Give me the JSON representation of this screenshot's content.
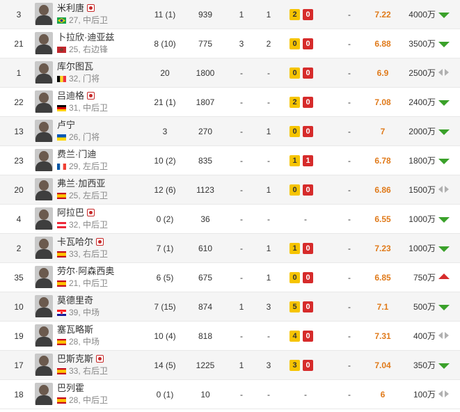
{
  "players": [
    {
      "number": "3",
      "name": "米利唐",
      "captain": true,
      "flag": "brazil",
      "age_pos": "27, 中后卫",
      "apps": "11 (1)",
      "minutes": "939",
      "goals": "1",
      "assists": "1",
      "yellow": "2",
      "red": "0",
      "plus": "-",
      "rating": "7.22",
      "value": "4000万",
      "trend": "down"
    },
    {
      "number": "21",
      "name": "卜拉欣·迪亚兹",
      "captain": false,
      "flag": "morocco",
      "age_pos": "25, 右边锋",
      "apps": "8 (10)",
      "minutes": "775",
      "goals": "3",
      "assists": "2",
      "yellow": "0",
      "red": "0",
      "plus": "-",
      "rating": "6.88",
      "value": "3500万",
      "trend": "down"
    },
    {
      "number": "1",
      "name": "库尔图瓦",
      "captain": false,
      "flag": "belgium",
      "age_pos": "32, 门将",
      "apps": "20",
      "minutes": "1800",
      "goals": "-",
      "assists": "-",
      "yellow": "0",
      "red": "0",
      "plus": "-",
      "rating": "6.9",
      "value": "2500万",
      "trend": "flat"
    },
    {
      "number": "22",
      "name": "吕迪格",
      "captain": true,
      "flag": "germany",
      "age_pos": "31, 中后卫",
      "apps": "21 (1)",
      "minutes": "1807",
      "goals": "-",
      "assists": "-",
      "yellow": "2",
      "red": "0",
      "plus": "-",
      "rating": "7.08",
      "value": "2400万",
      "trend": "down"
    },
    {
      "number": "13",
      "name": "卢宁",
      "captain": false,
      "flag": "ukraine",
      "age_pos": "26, 门将",
      "apps": "3",
      "minutes": "270",
      "goals": "-",
      "assists": "1",
      "yellow": "0",
      "red": "0",
      "plus": "-",
      "rating": "7",
      "value": "2000万",
      "trend": "down"
    },
    {
      "number": "23",
      "name": "费兰·门迪",
      "captain": false,
      "flag": "france",
      "age_pos": "29, 左后卫",
      "apps": "10 (2)",
      "minutes": "835",
      "goals": "-",
      "assists": "-",
      "yellow": "1",
      "red": "1",
      "plus": "-",
      "rating": "6.78",
      "value": "1800万",
      "trend": "down"
    },
    {
      "number": "20",
      "name": "弗兰·加西亚",
      "captain": false,
      "flag": "spain",
      "age_pos": "25, 左后卫",
      "apps": "12 (6)",
      "minutes": "1123",
      "goals": "-",
      "assists": "1",
      "yellow": "0",
      "red": "0",
      "plus": "-",
      "rating": "6.86",
      "value": "1500万",
      "trend": "flat"
    },
    {
      "number": "4",
      "name": "阿拉巴",
      "captain": true,
      "flag": "austria",
      "age_pos": "32, 中后卫",
      "apps": "0 (2)",
      "minutes": "36",
      "goals": "-",
      "assists": "-",
      "yellow": "",
      "red": "",
      "plus": "-",
      "rating": "6.55",
      "value": "1000万",
      "trend": "down"
    },
    {
      "number": "2",
      "name": "卡瓦哈尔",
      "captain": true,
      "flag": "spain",
      "age_pos": "33, 右后卫",
      "apps": "7 (1)",
      "minutes": "610",
      "goals": "-",
      "assists": "1",
      "yellow": "1",
      "red": "0",
      "plus": "-",
      "rating": "7.23",
      "value": "1000万",
      "trend": "down"
    },
    {
      "number": "35",
      "name": "劳尔·阿森西奥",
      "captain": false,
      "flag": "spain",
      "age_pos": "21, 中后卫",
      "apps": "6 (5)",
      "minutes": "675",
      "goals": "-",
      "assists": "1",
      "yellow": "0",
      "red": "0",
      "plus": "-",
      "rating": "6.85",
      "value": "750万",
      "trend": "up"
    },
    {
      "number": "10",
      "name": "莫德里奇",
      "captain": false,
      "flag": "croatia",
      "age_pos": "39, 中场",
      "apps": "7 (15)",
      "minutes": "874",
      "goals": "1",
      "assists": "3",
      "yellow": "5",
      "red": "0",
      "plus": "-",
      "rating": "7.1",
      "value": "500万",
      "trend": "down"
    },
    {
      "number": "19",
      "name": "塞瓦略斯",
      "captain": false,
      "flag": "spain",
      "age_pos": "28, 中场",
      "apps": "10 (4)",
      "minutes": "818",
      "goals": "-",
      "assists": "-",
      "yellow": "4",
      "red": "0",
      "plus": "-",
      "rating": "7.31",
      "value": "400万",
      "trend": "flat"
    },
    {
      "number": "17",
      "name": "巴斯克斯",
      "captain": true,
      "flag": "spain",
      "age_pos": "33, 右后卫",
      "apps": "14 (5)",
      "minutes": "1225",
      "goals": "1",
      "assists": "3",
      "yellow": "3",
      "red": "0",
      "plus": "-",
      "rating": "7.04",
      "value": "350万",
      "trend": "down"
    },
    {
      "number": "18",
      "name": "巴列霍",
      "captain": false,
      "flag": "spain",
      "age_pos": "28, 中后卫",
      "apps": "0 (1)",
      "minutes": "10",
      "goals": "-",
      "assists": "-",
      "yellow": "",
      "red": "",
      "plus": "-",
      "rating": "6",
      "value": "100万",
      "trend": "flat"
    }
  ],
  "colors": {
    "rating": "#e07a1a",
    "yellow_card": "#f6c400",
    "red_card": "#d62b2b",
    "trend_down": "#3aa12a",
    "trend_up": "#d62b2b",
    "trend_flat": "#b0b0b0"
  }
}
